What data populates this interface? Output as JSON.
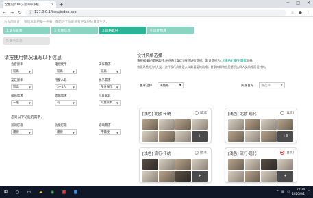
{
  "browser": {
    "tab_title": "全屋设计中心-室内带系统",
    "url": "127.0.0.1/ikea/index.asp"
  },
  "notice": "为你而设计！ 我们早就把每一件事，都是为了你能拥有更美好的日常生活。",
  "steps": [
    {
      "label": "1.填写资料",
      "state": "done"
    },
    {
      "label": "2.房屋信息",
      "state": "done"
    },
    {
      "label": "3.风格喜好",
      "state": "active"
    },
    {
      "label": "4.设计预算",
      "state": "done"
    },
    {
      "label": "5.服务信息",
      "state": "disabled"
    }
  ],
  "left": {
    "heading": "请按使用情况填写以下信息",
    "fields": [
      {
        "label": "会客频率",
        "value": "较高"
      },
      {
        "label": "电视使用",
        "value": "较高"
      },
      {
        "label": "工作需求",
        "value": "较高"
      },
      {
        "label": "宴饮频率",
        "value": "较高"
      },
      {
        "label": "用餐人数",
        "value": "3~4人"
      },
      {
        "label": "展示需求",
        "value": "部分展示"
      },
      {
        "label": "储物需求",
        "value": "一般"
      },
      {
        "label": "衣帽需求",
        "value": "有"
      },
      {
        "label": "儿童家具",
        "value": "儿童家具"
      }
    ],
    "section2": "您对以下功能的需求：",
    "fields2": [
      {
        "label": "双洞灯箱",
        "value": "需要"
      },
      {
        "label": "功能灯箱",
        "value": "需要"
      },
      {
        "label": "玻璃需求",
        "value": "不需要"
      }
    ]
  },
  "right": {
    "heading": "设计风格选择",
    "sub_prefix": "请根据偏好提供喜好,并点击 [喜欢] 按钮进行选择。默认选择为：",
    "sub_default": "[浅色] 流行·现代",
    "sub_suffix": "风格。",
    "desc": "曾家风格分为6大类。流行现代风格是大众最喜爱的风格，曾家的精装也是基于这四大类风格而设计的。",
    "color_label": "色彩选择",
    "color_value": "浅色系",
    "style_label": "风格喜好",
    "style_value": "请选择..",
    "radio_label": "[喜欢]",
    "cards": [
      {
        "title": "[浅色] 北欧·传统",
        "checked": false,
        "more": "+"
      },
      {
        "title": "[浅色] 北欧·现代",
        "checked": false,
        "more": "+3"
      },
      {
        "title": "[浅色] 流行·传统",
        "checked": false,
        "more": "+"
      },
      {
        "title": "[浅色] 流行·现代",
        "checked": true,
        "more": "+"
      }
    ]
  },
  "taskbar": {
    "time": "22:24",
    "date": "2020/6/1"
  }
}
